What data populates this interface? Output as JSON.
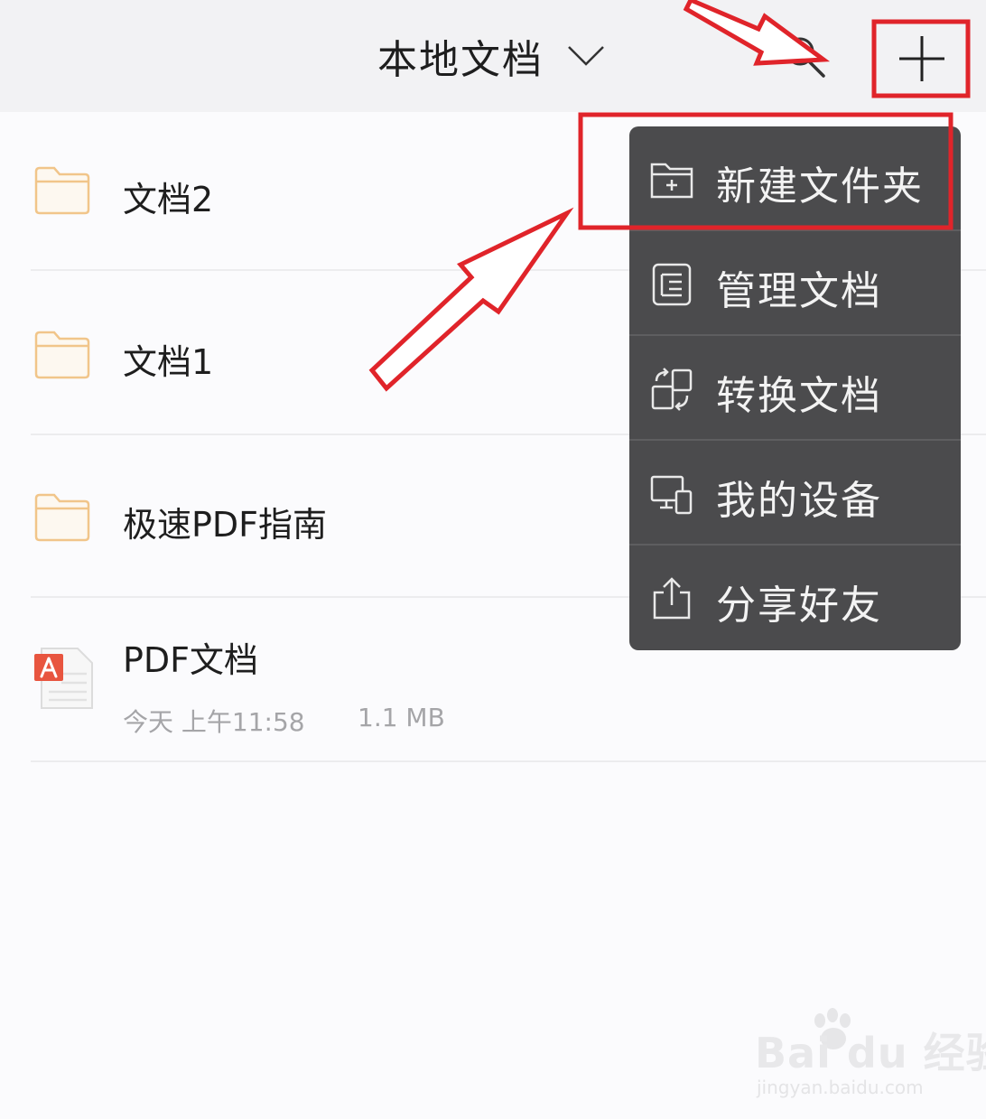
{
  "header": {
    "title": "本地文档"
  },
  "files": [
    {
      "name": "文档2",
      "type": "folder"
    },
    {
      "name": "文档1",
      "type": "folder"
    },
    {
      "name": "极速PDF指南",
      "type": "folder"
    },
    {
      "name": "PDF文档",
      "type": "pdf",
      "date": "今天 上午11:58",
      "size": "1.1 MB"
    }
  ],
  "menu": {
    "items": [
      {
        "label": "新建文件夹",
        "icon": "new-folder-icon"
      },
      {
        "label": "管理文档",
        "icon": "manage-icon"
      },
      {
        "label": "转换文档",
        "icon": "convert-icon"
      },
      {
        "label": "我的设备",
        "icon": "device-icon"
      },
      {
        "label": "分享好友",
        "icon": "share-icon"
      }
    ]
  },
  "watermark": {
    "main": "Bai du 经验",
    "sub": "jingyan.baidu.com"
  },
  "colors": {
    "folder": "#f1c58a",
    "menu_bg": "#4b4b4d",
    "annotation": "#e0242a",
    "pdf_red": "#e8553f"
  }
}
